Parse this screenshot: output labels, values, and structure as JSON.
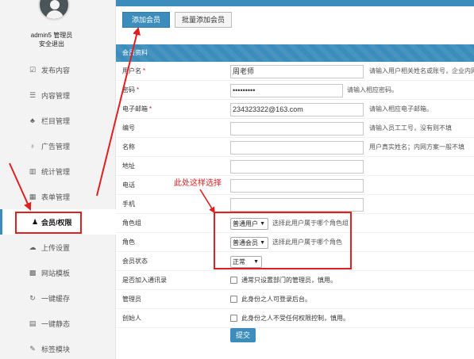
{
  "sidebar": {
    "user_name": "admin5 管理员",
    "logout": "安全退出",
    "items": [
      {
        "label": "发布内容",
        "icon": "edit-icon",
        "glyph": "☑"
      },
      {
        "label": "内容管理",
        "icon": "list-icon",
        "glyph": "☰"
      },
      {
        "label": "栏目管理",
        "icon": "sitemap-icon",
        "glyph": "♣"
      },
      {
        "label": "广告管理",
        "icon": "pin-icon",
        "glyph": "♁"
      },
      {
        "label": "统计管理",
        "icon": "bar-chart-icon",
        "glyph": "▥"
      },
      {
        "label": "表单管理",
        "icon": "table-icon",
        "glyph": "▦"
      },
      {
        "label": "会员/权限",
        "icon": "users-icon",
        "glyph": "♟"
      },
      {
        "label": "上传设置",
        "icon": "cloud-upload-icon",
        "glyph": "☁"
      },
      {
        "label": "网站模板",
        "icon": "grid-icon",
        "glyph": "▩"
      },
      {
        "label": "一键缓存",
        "icon": "refresh-icon",
        "glyph": "↻"
      },
      {
        "label": "一键静态",
        "icon": "file-icon",
        "glyph": "▤"
      },
      {
        "label": "标签模块",
        "icon": "magic-icon",
        "glyph": "✎"
      }
    ]
  },
  "toolbar": {
    "add_member": "添加会员",
    "batch_add": "批量添加会员"
  },
  "panel": {
    "title": "会员资料"
  },
  "form": {
    "username": {
      "label": "用户名",
      "required": "*",
      "value": "周老师",
      "hint": "请输入用户相关姓名或账号，企业内网"
    },
    "password": {
      "label": "密码",
      "required": "*",
      "value": "•••••••••",
      "hint": "请输入相应密码。"
    },
    "email": {
      "label": "电子邮箱",
      "required": "*",
      "value": "234323322@163.com",
      "hint": "请输入相应电子邮箱。"
    },
    "number": {
      "label": "编号",
      "value": "",
      "hint": "请输入员工工号，没有则不填"
    },
    "name": {
      "label": "名称",
      "value": "",
      "hint": "用户真实姓名；内网方案一般不填"
    },
    "address": {
      "label": "地址",
      "value": ""
    },
    "phone": {
      "label": "电话",
      "value": ""
    },
    "mobile": {
      "label": "手机",
      "value": ""
    },
    "role_group": {
      "label": "角色组",
      "value": "普通用户",
      "hint": "选择此用户属于哪个角色组"
    },
    "role": {
      "label": "角色",
      "value": "普通会员",
      "hint": "选择此用户属于哪个角色"
    },
    "status": {
      "label": "会员状态",
      "value": "正常"
    },
    "contacts": {
      "label": "是否加入通讯录",
      "text": "通常只设置部门的管理员，慎用。"
    },
    "admin": {
      "label": "管理员",
      "text": "此身份之人可登录后台。"
    },
    "founder": {
      "label": "创始人",
      "text": "此身份之人不受任何权限控制，慎用。"
    },
    "submit": "提交"
  },
  "annotation": {
    "text": "此处这样选择",
    "color": "#e02020"
  },
  "colors": {
    "primary": "#3c8dbc",
    "highlight": "#e02020"
  }
}
